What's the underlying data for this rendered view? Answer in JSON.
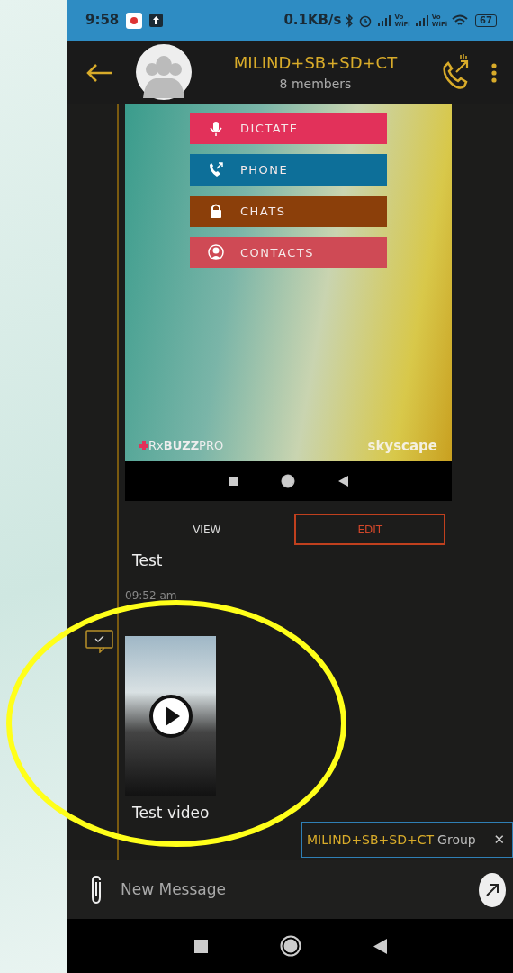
{
  "status_bar": {
    "time": "9:58",
    "speed": "0.1KB/s",
    "wifi_calling": [
      {
        "top": "Vo",
        "bottom": "WiFi"
      },
      {
        "top": "Vo",
        "bottom": "WiFi"
      }
    ],
    "battery": "67"
  },
  "header": {
    "title": "MILIND+SB+SD+CT",
    "subtitle": "8 members"
  },
  "messages": [
    {
      "kind": "image",
      "delivered": false,
      "menu_items": [
        {
          "label": "DICTATE",
          "color": "#e2315a"
        },
        {
          "label": "PHONE",
          "color": "#0d6f99"
        },
        {
          "label": "CHATS",
          "color": "#8b3f0a"
        },
        {
          "label": "CONTACTS",
          "color": "#cf4a55"
        }
      ],
      "brand_left": "Rx**BUZZ**PRO",
      "brand_right": "skyscape",
      "actions": [
        {
          "label": "VIEW",
          "selected": false
        },
        {
          "label": "EDIT",
          "selected": true
        }
      ],
      "caption": "Test",
      "time": "09:52 am"
    },
    {
      "kind": "video",
      "delivered": true,
      "caption": "Test video"
    }
  ],
  "banner": {
    "group": "MILIND+SB+SD+CT",
    "suffix": "Group",
    "close": "✕"
  },
  "composer": {
    "placeholder": "New Message"
  }
}
